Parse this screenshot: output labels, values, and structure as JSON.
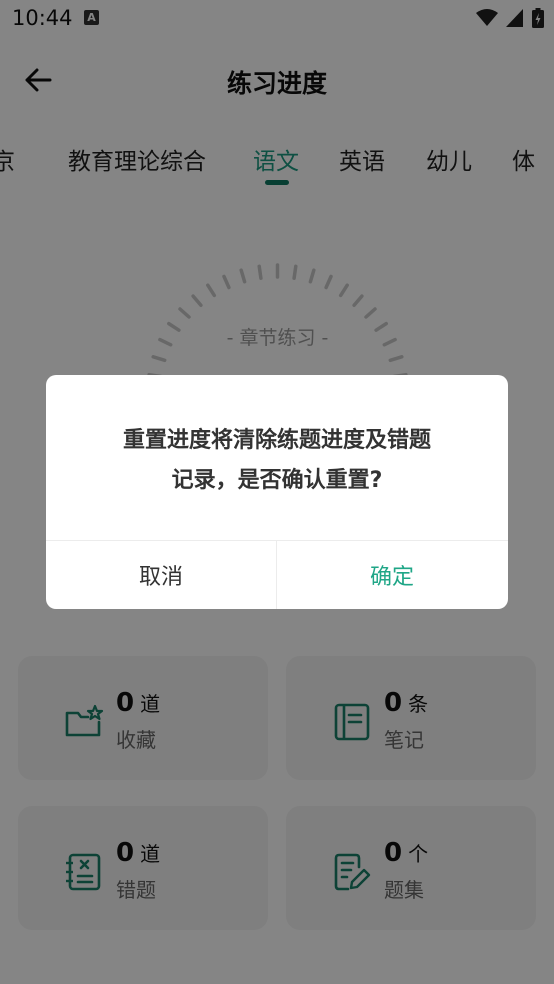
{
  "status_bar": {
    "time": "10:44",
    "notification_glyph": "A",
    "icons": [
      "wifi-icon",
      "cell-signal-icon",
      "battery-icon"
    ]
  },
  "header": {
    "title": "练习进度",
    "back_icon": "arrow-left-icon"
  },
  "tabs": [
    {
      "label": "京",
      "active": false
    },
    {
      "label": "教育理论综合",
      "active": false
    },
    {
      "label": "语文",
      "active": true
    },
    {
      "label": "英语",
      "active": false
    },
    {
      "label": "幼儿",
      "active": false
    },
    {
      "label": "体",
      "active": false
    }
  ],
  "gauge": {
    "label": "- 章节练习 -"
  },
  "stats": [
    {
      "count": "0",
      "unit": "道",
      "label": "收藏",
      "icon": "folder-star-icon"
    },
    {
      "count": "0",
      "unit": "条",
      "label": "笔记",
      "icon": "notebook-icon"
    },
    {
      "count": "0",
      "unit": "道",
      "label": "错题",
      "icon": "wrong-question-icon"
    },
    {
      "count": "0",
      "unit": "个",
      "label": "题集",
      "icon": "edit-document-icon"
    }
  ],
  "dialog": {
    "message_line1": "重置进度将清除练题进度及错题",
    "message_line2": "记录，是否确认重置?",
    "cancel_label": "取消",
    "confirm_label": "确定"
  },
  "colors": {
    "accent": "#1fa687",
    "tab_indicator": "#117a63",
    "icon_green": "#1a7f68"
  }
}
